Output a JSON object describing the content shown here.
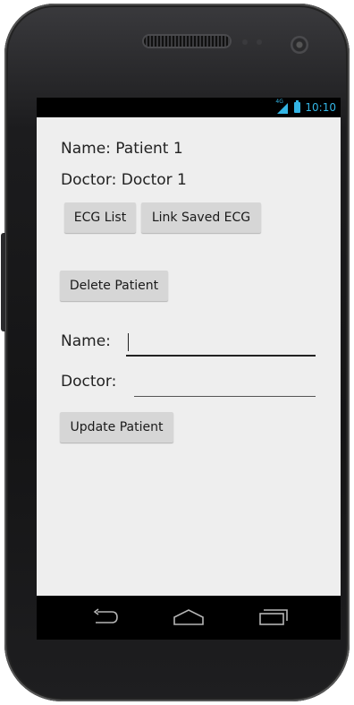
{
  "status_bar": {
    "network_type": "4G",
    "time": "10:10",
    "accent_color": "#33b5e5"
  },
  "patient": {
    "name_line": "Name: Patient 1",
    "doctor_line": "Doctor: Doctor 1"
  },
  "buttons": {
    "ecg_list": "ECG List",
    "link_saved_ecg": "Link Saved ECG",
    "delete_patient": "Delete Patient",
    "update_patient": "Update Patient"
  },
  "form": {
    "name_label": "Name:",
    "name_value": "",
    "doctor_label": "Doctor:",
    "doctor_value": ""
  },
  "nav_bar": {
    "icons": [
      "back-icon",
      "home-icon",
      "recent-apps-icon"
    ]
  },
  "colors": {
    "app_background": "#eeeeee",
    "button_background": "#d6d6d6",
    "status_icons": "#33b5e5"
  }
}
